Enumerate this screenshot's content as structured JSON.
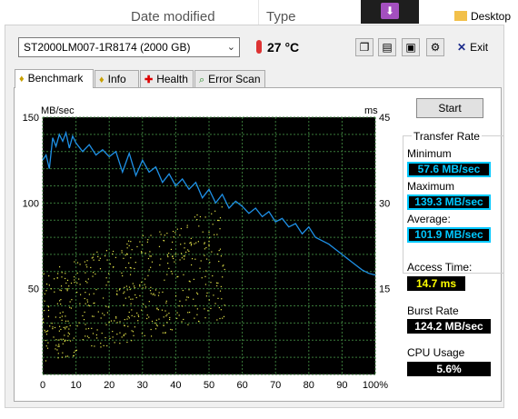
{
  "background": {
    "col_date_modified": "Date modified",
    "col_type": "Type",
    "desktop_label": "Desktop"
  },
  "toolbar": {
    "drive": "ST2000LM007-1R8174 (2000 GB)",
    "temperature": "27 °C",
    "exit_label": "Exit"
  },
  "tabs": [
    {
      "label": "Benchmark",
      "icon": "benchmark-icon"
    },
    {
      "label": "Info",
      "icon": "info-icon"
    },
    {
      "label": "Health",
      "icon": "health-cross-icon"
    },
    {
      "label": "Error Scan",
      "icon": "magnifier-icon"
    }
  ],
  "stats": {
    "start_label": "Start",
    "transfer_rate_title": "Transfer Rate",
    "minimum_label": "Minimum",
    "minimum_value": "57.6 MB/sec",
    "maximum_label": "Maximum",
    "maximum_value": "139.3 MB/sec",
    "average_label": "Average:",
    "average_value": "101.9 MB/sec",
    "access_time_label": "Access Time:",
    "access_time_value": "14.7 ms",
    "burst_rate_label": "Burst Rate",
    "burst_rate_value": "124.2 MB/sec",
    "cpu_usage_label": "CPU Usage",
    "cpu_usage_value": "5.6%"
  },
  "chart_data": {
    "type": "line",
    "ylabel_left": "MB/sec",
    "ylabel_right": "ms",
    "yticks_left": [
      "150",
      "100",
      "50"
    ],
    "yticks_right": [
      "45",
      "30",
      "15"
    ],
    "xticks": [
      "0",
      "10",
      "20",
      "30",
      "40",
      "50",
      "60",
      "70",
      "80",
      "90",
      "100%"
    ],
    "xlim": [
      0,
      100
    ],
    "ylim_left": [
      0,
      150
    ],
    "ylim_right": [
      0,
      45
    ],
    "colors": {
      "transfer": "#1e90e6",
      "access": "#e6e64a",
      "bg": "#000000",
      "grid": "#3a7a3a"
    },
    "series": [
      {
        "name": "Transfer Rate",
        "x": [
          0,
          1,
          2,
          3,
          4,
          5,
          6,
          7,
          8,
          9,
          10,
          12,
          14,
          16,
          18,
          20,
          22,
          24,
          26,
          28,
          30,
          32,
          34,
          36,
          38,
          40,
          42,
          44,
          46,
          48,
          50,
          52,
          54,
          56,
          58,
          60,
          62,
          64,
          66,
          68,
          70,
          72,
          74,
          76,
          78,
          80,
          82,
          84,
          86,
          88,
          90,
          92,
          94,
          96,
          98,
          100
        ],
        "y": [
          125,
          128,
          120,
          138,
          133,
          140,
          136,
          141,
          132,
          139,
          135,
          130,
          134,
          128,
          131,
          127,
          130,
          118,
          129,
          116,
          125,
          118,
          121,
          112,
          117,
          110,
          114,
          108,
          112,
          103,
          108,
          100,
          105,
          97,
          101,
          98,
          94,
          97,
          92,
          95,
          89,
          91,
          86,
          88,
          82,
          86,
          80,
          78,
          76,
          73,
          70,
          67,
          64,
          61,
          59,
          58
        ]
      },
      {
        "name": "Access Time",
        "x_range": [
          0,
          55
        ],
        "y_range_ms": [
          2,
          30
        ],
        "style": "scatter"
      }
    ]
  }
}
